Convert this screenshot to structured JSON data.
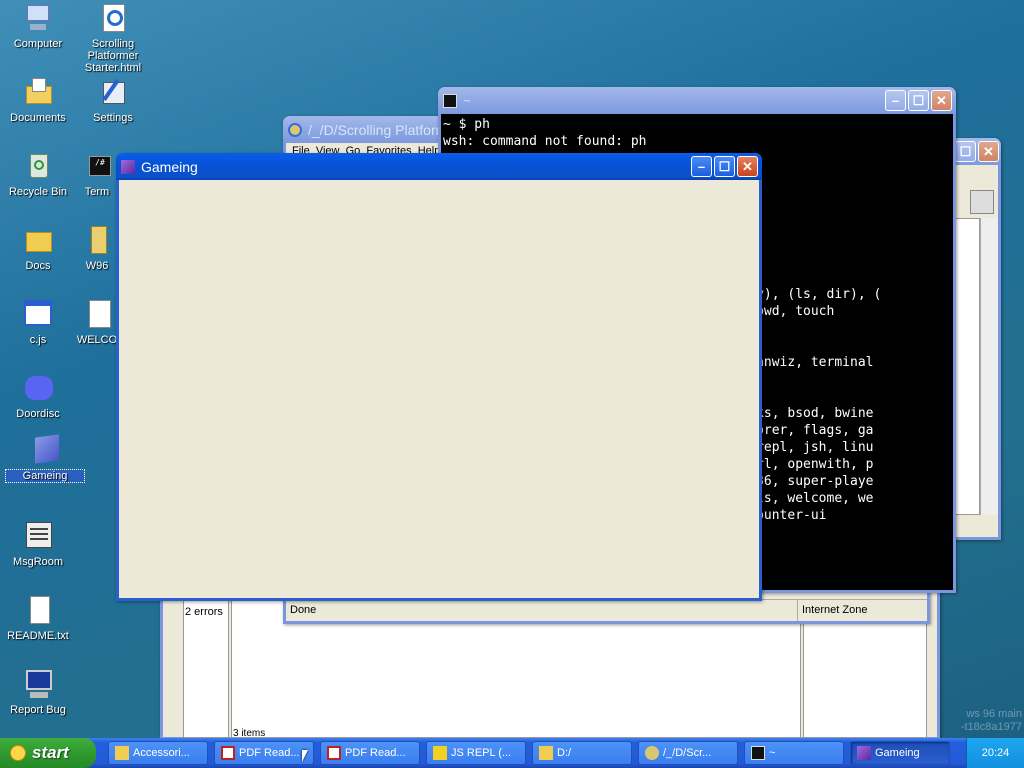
{
  "desktop": {
    "icons": [
      {
        "label": "Computer",
        "icon": "computer-icon"
      },
      {
        "label": "Scrolling Platformer Starter.html",
        "icon": "ie-icon"
      },
      {
        "label": "Documents",
        "icon": "documents-icon"
      },
      {
        "label": "Settings",
        "icon": "settings-icon"
      },
      {
        "label": "Recycle Bin",
        "icon": "recycle-bin-icon"
      },
      {
        "label": "Term",
        "icon": "terminal-icon"
      },
      {
        "label": "Docs",
        "icon": "folder-icon"
      },
      {
        "label": "W96",
        "icon": "zip-icon"
      },
      {
        "label": "c.js",
        "icon": "js-file-icon"
      },
      {
        "label": "WELCO",
        "icon": "welcome-icon"
      },
      {
        "label": "Doordisc",
        "icon": "discord-icon"
      },
      {
        "label": "Gameing",
        "icon": "gameing-icon"
      },
      {
        "label": "MsgRoom",
        "icon": "msgroom-icon"
      },
      {
        "label": "README.txt",
        "icon": "text-file-icon"
      },
      {
        "label": "Report Bug",
        "icon": "report-bug-icon"
      }
    ],
    "watermark": "ws 96 main\n-t18c8a1977"
  },
  "explorer_window": {
    "title": "/_/D/Scrolling Platformer Starter.html",
    "menu_partial": "File  View  Go  Favorites  Help",
    "status_left": "Done",
    "status_right": "Internet Zone"
  },
  "bottom_window": {
    "status_errors": "2 errors",
    "status_items": "3 items"
  },
  "terminal_window": {
    "title": "~",
    "lines": [
      "~ $ ph",
      "wsh: command not found: ph",
      "",
      "",
      "",
      "",
      "",
      "",
      "",
      "",
      "                                (cp, copy), (ls, dir), (",
      "                               o, icon, pwd, touch",
      "",
      "",
      "                                ppp2, scanwiz, terminal",
      "",
      "",
      "                               oon, blocks, bsod, bwine",
      "                               nts, explorer, flags, ga",
      "                               te, jsguirepl, jsh, linu",
      "                               on, openurl, openwith, p",
      "                               rd, shell36, super-playe",
      "                                wasm-tools, welcome, we",
      "                               ce, zip-mounter-ui"
    ]
  },
  "gameing_window": {
    "title": "Gameing"
  },
  "taskbar": {
    "start_label": "start",
    "buttons": [
      {
        "label": "Accessori...",
        "icon": "folder-icon"
      },
      {
        "label": "PDF Read...",
        "icon": "pdf-icon"
      },
      {
        "label": "PDF Read...",
        "icon": "pdf-icon"
      },
      {
        "label": "JS REPL (...",
        "icon": "js-icon"
      },
      {
        "label": "D:/",
        "icon": "folder-icon"
      },
      {
        "label": "/_/D/Scr...",
        "icon": "ie-icon"
      },
      {
        "label": "~",
        "icon": "terminal-icon"
      },
      {
        "label": "Gameing",
        "icon": "gameing-icon"
      }
    ],
    "clock": "20:24"
  }
}
